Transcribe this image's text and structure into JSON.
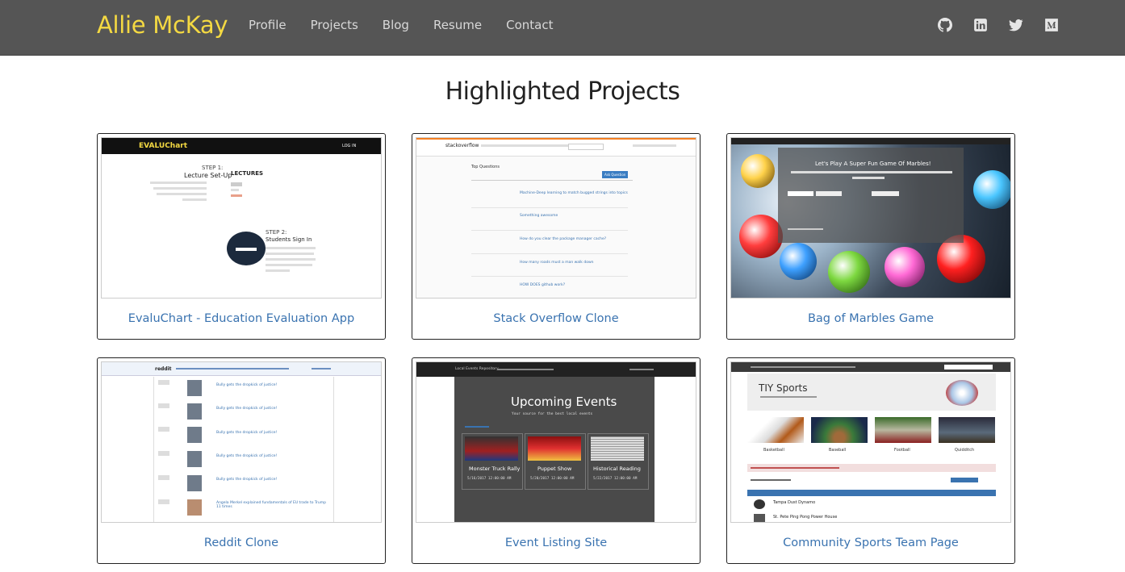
{
  "brand": "Allie McKay",
  "nav": [
    "Profile",
    "Projects",
    "Blog",
    "Resume",
    "Contact"
  ],
  "social": [
    "github-icon",
    "linkedin-icon",
    "twitter-icon",
    "medium-icon"
  ],
  "heading": "Highlighted Projects",
  "projects": [
    {
      "title": "EvaluChart - Education Evaluation App",
      "thumb": {
        "logo": "EVALUChart",
        "login": "LOG IN",
        "step1": "STEP 1:",
        "step1_title": "Lecture Set-Up",
        "lectures": "LECTURES",
        "step2": "STEP 2:",
        "step2_title": "Students Sign In"
      }
    },
    {
      "title": "Stack Overflow Clone",
      "thumb": {
        "logo": "stackoverflow",
        "section": "Top Questions",
        "ask": "Ask Question",
        "questions": [
          "Machine-Deep learning to match bugged strings into topics",
          "Something awesome",
          "How do you clear the package manager cache?",
          "How many roads must a man walk down",
          "HOW DOES github work?"
        ]
      }
    },
    {
      "title": "Bag of Marbles Game",
      "thumb": {
        "headline": "Let's Play A Super Fun Game Of Marbles!"
      }
    },
    {
      "title": "Reddit Clone",
      "thumb": {
        "logo": "reddit",
        "posts": [
          "Bully gets the dropkick of justice!",
          "Bully gets the dropkick of justice!",
          "Bully gets the dropkick of justice!",
          "Bully gets the dropkick of justice!",
          "Bully gets the dropkick of justice!",
          "Angela Merkel explained fundamentals of EU trade to Trump 11 times"
        ]
      }
    },
    {
      "title": "Event Listing Site",
      "thumb": {
        "site": "Local Events Repository",
        "hero": "Upcoming Events",
        "sub": "Your source for the best local events",
        "events": [
          {
            "name": "Monster Truck Rally",
            "date": "5/16/2017 12:00:00 AM"
          },
          {
            "name": "Puppet Show",
            "date": "5/20/2017 12:00:00 AM"
          },
          {
            "name": "Historical Reading",
            "date": "5/22/2017 12:00:00 AM"
          }
        ]
      }
    },
    {
      "title": "Community Sports Team Page",
      "thumb": {
        "site": "TIY Sports",
        "sports": [
          "Basketball",
          "Baseball",
          "Football",
          "Quidditch"
        ],
        "teams": [
          "Tampa Dust Dynamo",
          "St. Pete Ping Pong Power House"
        ]
      }
    }
  ],
  "colors": {
    "navbar": "#555555",
    "brand": "#f4d942",
    "link": "#3a73b0"
  }
}
